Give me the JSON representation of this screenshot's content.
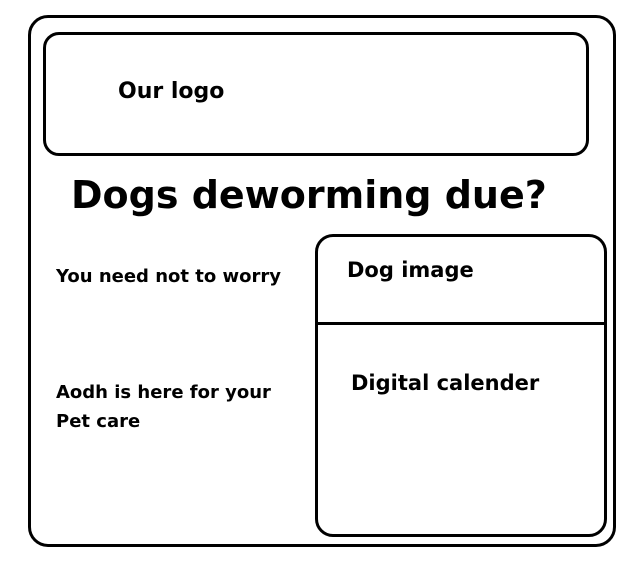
{
  "header": {
    "logo_text": "Our logo"
  },
  "hero": {
    "headline": "Dogs deworming due?",
    "tagline_1": "You need not to worry",
    "tagline_2": "Aodh is here for your Pet care"
  },
  "media": {
    "dog_image_label": "Dog image",
    "calendar_label": "Digital calender"
  }
}
